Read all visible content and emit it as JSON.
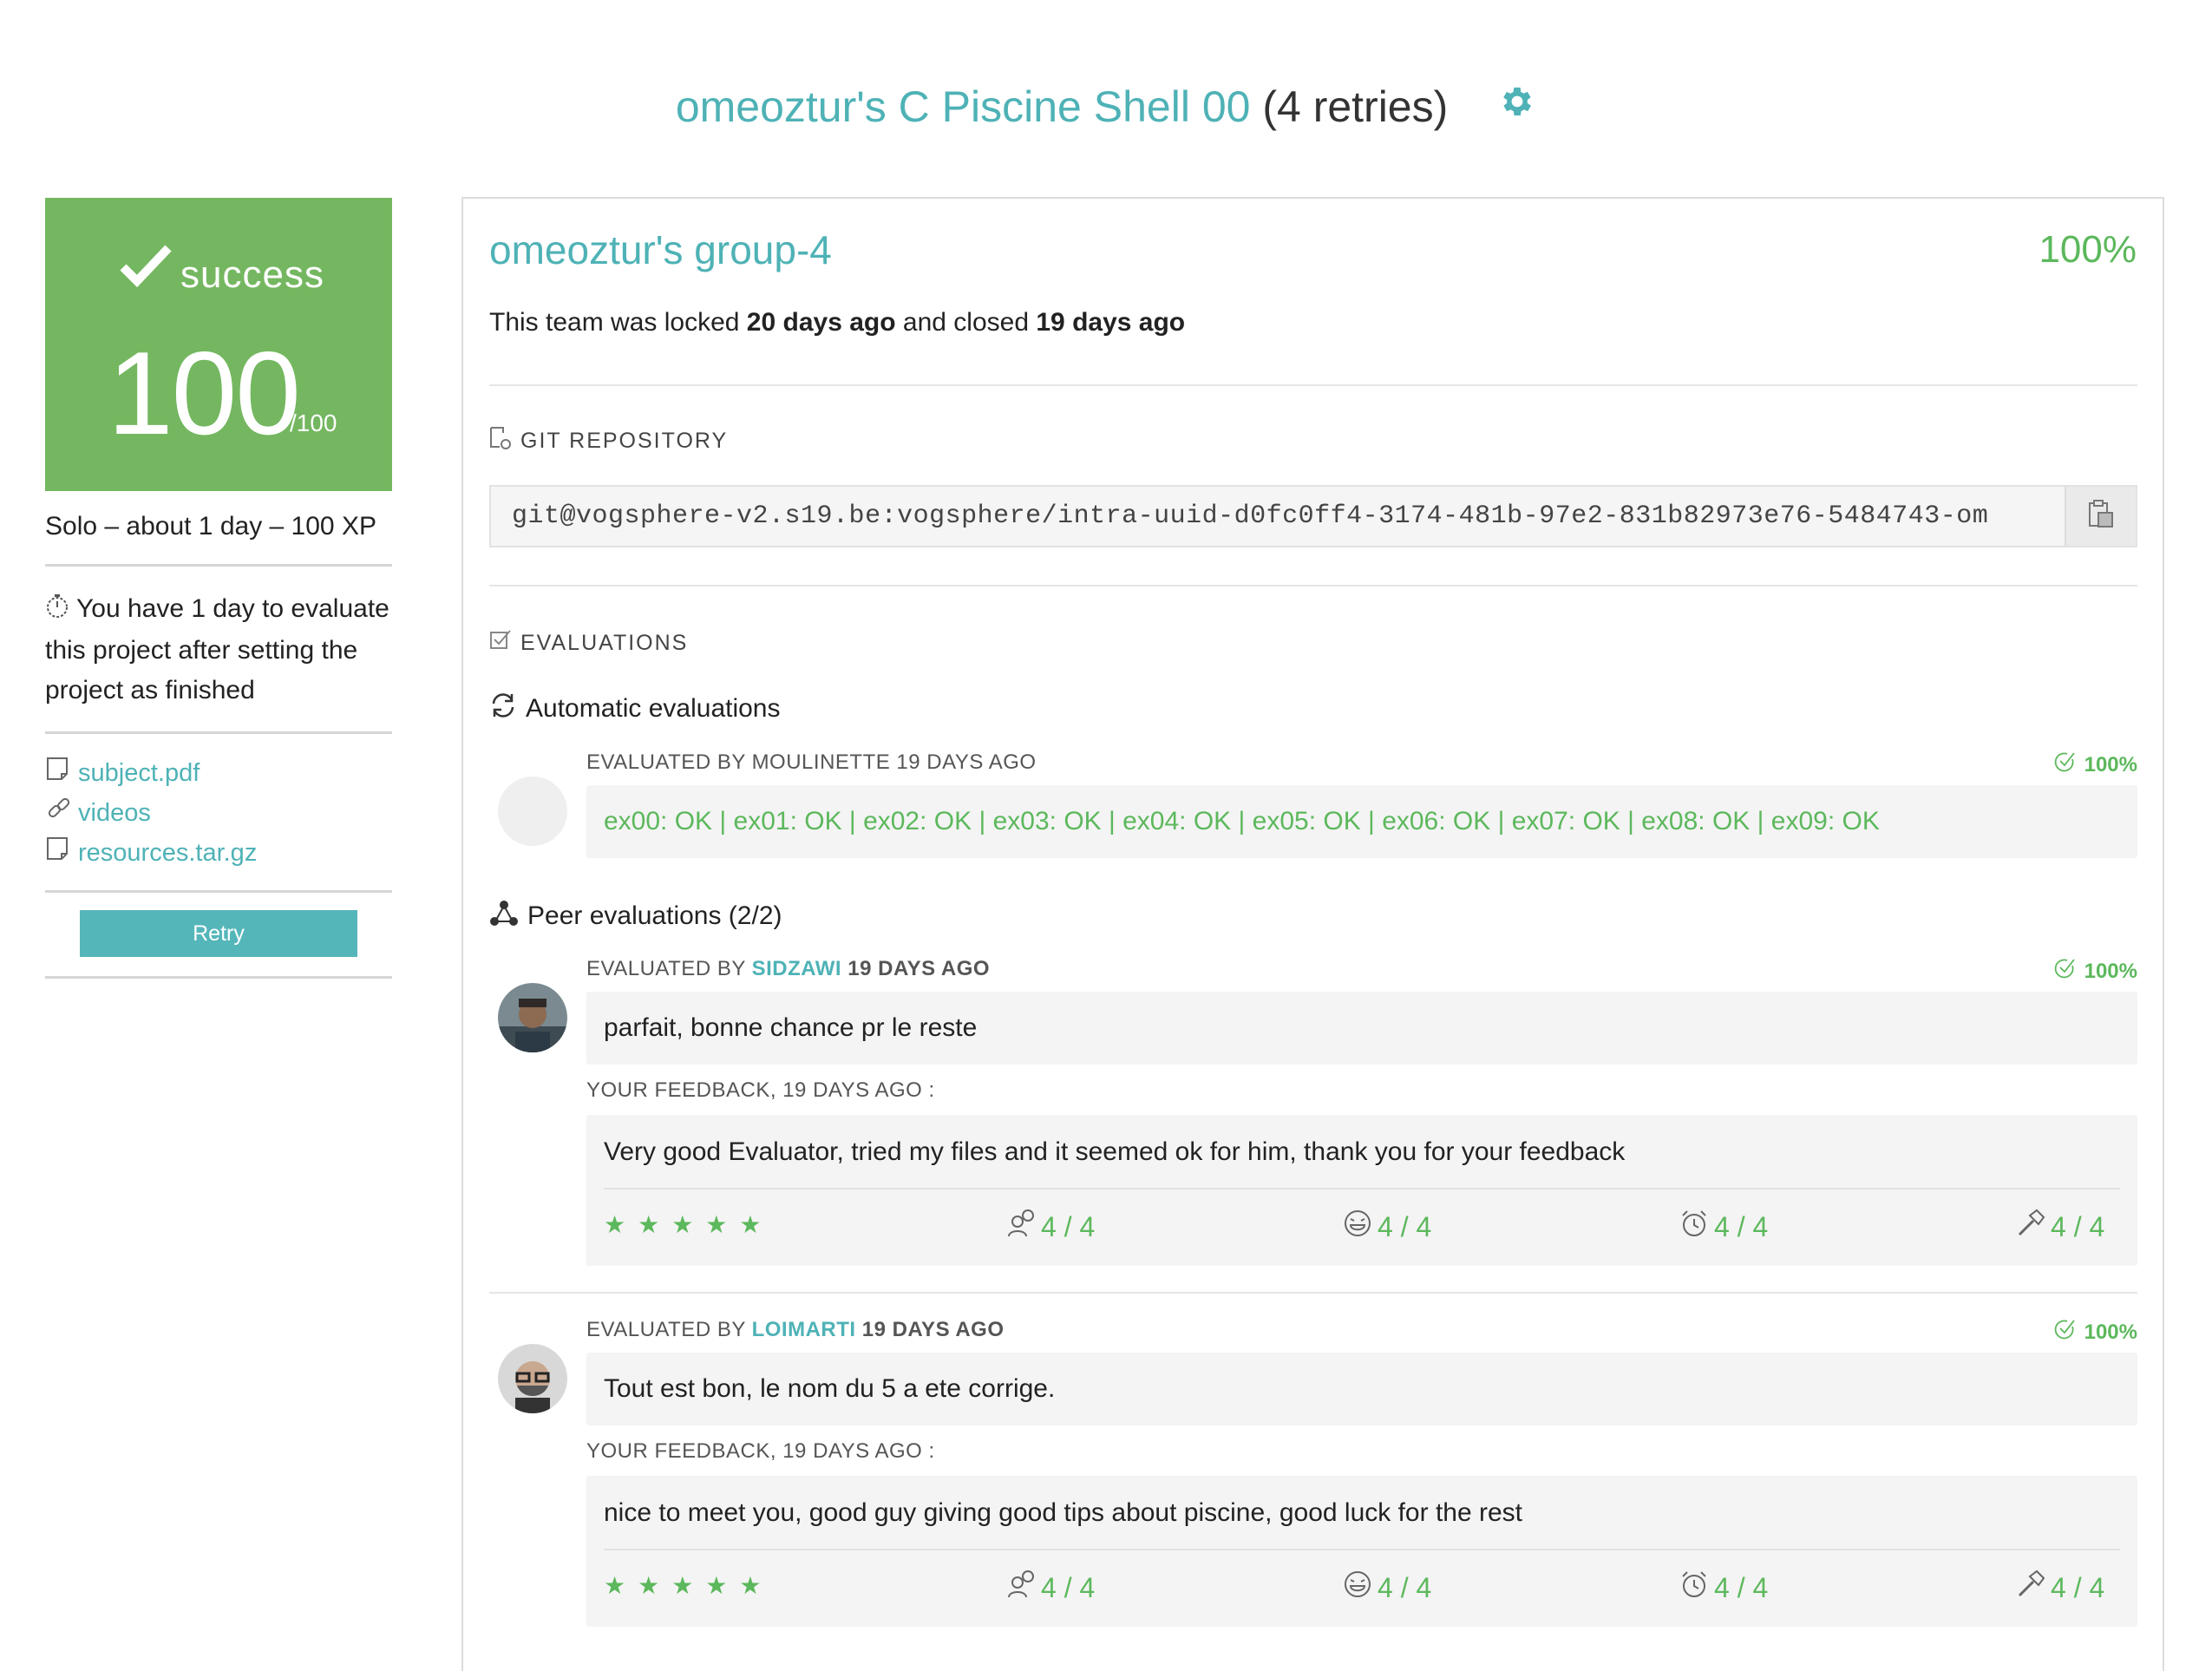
{
  "header": {
    "project_title": "omeoztur's C Piscine Shell 00",
    "retries": "(4 retries)"
  },
  "sidebar": {
    "status_label": "success",
    "score": "100",
    "score_max": "/100",
    "meta": "Solo – about 1 day – 100 XP",
    "eval_time": "You have 1 day to evaluate this project after setting the project as finished",
    "files": [
      {
        "label": "subject.pdf",
        "icon": "document-icon"
      },
      {
        "label": "videos",
        "icon": "link-icon"
      },
      {
        "label": "resources.tar.gz",
        "icon": "document-icon"
      }
    ],
    "retry_label": "Retry"
  },
  "team": {
    "name": "omeoztur's group-4",
    "percent": "100%",
    "lock_prefix": "This team was locked",
    "locked_ago": "20 days ago",
    "lock_mid": "and closed",
    "closed_ago": "19 days ago"
  },
  "git": {
    "heading": "GIT REPOSITORY",
    "url": "git@vogsphere-v2.s19.be:vogsphere/intra-uuid-d0fc0ff4-3174-481b-97e2-831b82973e76-5484743-om"
  },
  "evaluations": {
    "heading": "EVALUATIONS",
    "automatic_heading": "Automatic evaluations",
    "automatic": {
      "by": "EVALUATED BY MOULINETTE 19 DAYS AGO",
      "percent": "100%",
      "result": "ex00: OK | ex01: OK | ex02: OK | ex03: OK | ex04: OK | ex05: OK | ex06: OK | ex07: OK | ex08: OK | ex09: OK"
    },
    "peer_heading": "Peer evaluations (2/2)",
    "peers": [
      {
        "prefix": "EVALUATED BY",
        "login": "SIDZAWI",
        "ago": "19 DAYS AGO",
        "percent": "100%",
        "comment": "parfait, bonne chance pr le reste",
        "feedback_label": "YOUR FEEDBACK,  19 DAYS AGO :",
        "feedback": "Very good Evaluator, tried my files and it seemed ok for him, thank you for your feedback",
        "stars": "★★★★★",
        "scores": [
          "4 / 4",
          "4 / 4",
          "4 / 4",
          "4 / 4"
        ]
      },
      {
        "prefix": "EVALUATED BY",
        "login": "LOIMARTI",
        "ago": "19 DAYS AGO",
        "percent": "100%",
        "comment": "Tout est bon, le nom du 5 a ete corrige.",
        "feedback_label": "YOUR FEEDBACK,  19 DAYS AGO :",
        "feedback": "nice to meet you, good guy giving good tips about piscine, good luck for the rest",
        "stars": "★★★★★",
        "scores": [
          "4 / 4",
          "4 / 4",
          "4 / 4",
          "4 / 4"
        ]
      }
    ]
  },
  "colors": {
    "accent": "#4eb2b6",
    "success": "#5cb85c",
    "success_box": "#74b760"
  }
}
